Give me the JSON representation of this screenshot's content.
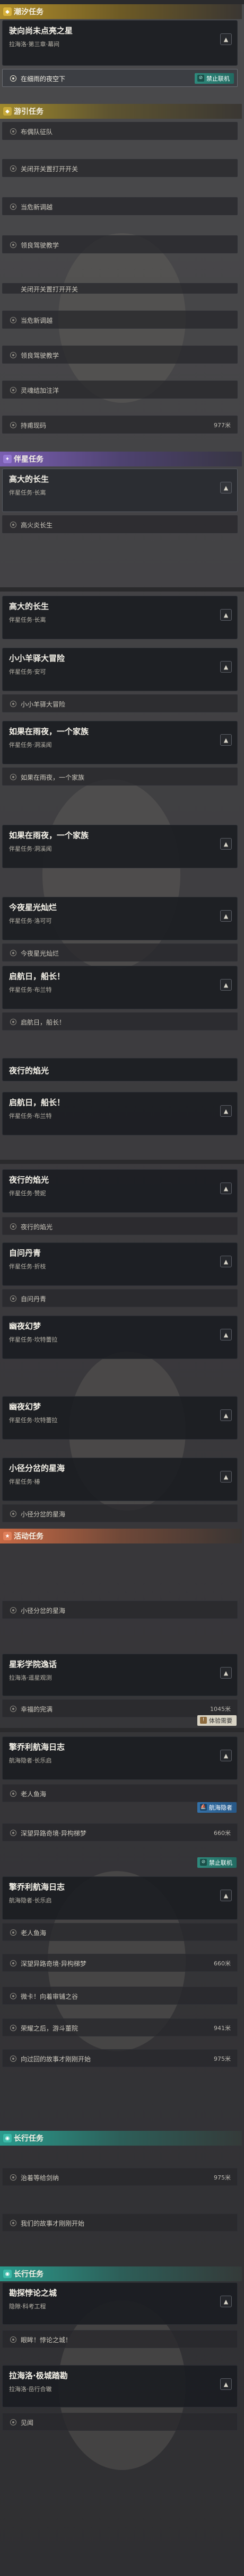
{
  "headers": {
    "main": "潮汐任务",
    "side": "游引任务",
    "companion": "伴星任务",
    "event": "活动任务",
    "daily": "长行任务",
    "daily2": "长行任务"
  },
  "cards": {
    "c1": {
      "title": "驶向尚未点亮之星",
      "sub": "拉海洛·第三章·幕间"
    },
    "c2": {
      "title": "高大的长生",
      "sub": "伴星任务·长离"
    },
    "c3": {
      "title": "高大的长生",
      "sub": "伴星任务·长离"
    },
    "c4": {
      "title": "小小羊驿大冒险",
      "sub": "伴星任务·安可"
    },
    "c5": {
      "title": "如果在雨夜，一个家族",
      "sub": "伴星任务·洞溪闻"
    },
    "c6": {
      "title": "如果在雨夜，一个家族",
      "sub": "伴星任务·洞溪闻"
    },
    "c7": {
      "title": "今夜星光灿烂",
      "sub": "伴星任务·洛可可"
    },
    "c8": {
      "title": "启航日，船长！",
      "sub": "伴星任务·布兰特"
    },
    "c9": {
      "title": "夜行的焰光",
      "sub": ""
    },
    "c10": {
      "title": "启航日，船长！",
      "sub": "伴星任务·布兰特"
    },
    "c11": {
      "title": "夜行的焰光",
      "sub": "伴星任务·赞妮"
    },
    "c12": {
      "title": "自问丹青",
      "sub": "伴星任务·折枝"
    },
    "c13": {
      "title": "幽夜幻梦",
      "sub": "伴星任务·坎特蕾拉"
    },
    "c14": {
      "title": "幽夜幻梦",
      "sub": "伴星任务·坎特蕾拉"
    },
    "c15": {
      "title": "小径分岔的星海",
      "sub": "伴星任务·椿"
    },
    "c16": {
      "title": "星彩学院逸话",
      "sub": "拉海洛·遥星观测"
    },
    "c17": {
      "title": "擎乔利航海日志",
      "sub": "航海隐者·长乐启"
    },
    "c18": {
      "title": "擎乔利航海日志",
      "sub": "航海隐者·长乐启"
    },
    "c19": {
      "title": "勘探悖论之城",
      "sub": "隐隙·科考工程"
    },
    "c20": {
      "title": "拉海洛·极城踏勘",
      "sub": "拉海洛·岳行合辙"
    }
  },
  "subs": {
    "s1": "在细雨的夜空下",
    "s2": "布偶队征队",
    "s3": "关闭开关置打开开关",
    "s4": "当危新调越",
    "s5": "领良驾驶教学",
    "s6": "关闭开关置打开开关",
    "s7": "当危新调越",
    "s8": "领良驾驶教学",
    "s9": "灵魂结加注洋",
    "s10": "持甫现码",
    "s11": "高火炎长生",
    "s12": "小小羊驿大冒险",
    "s13": "如果在雨夜，一个家族",
    "s14": "今夜星光灿烂",
    "s15": "启航日，船长！",
    "s16": "自问丹青",
    "s17": "夜行的焰光",
    "s18": "自问丹青",
    "s19": "小径分岔的星海",
    "s20": "小径分岔的星海",
    "s21": "幸福的完满",
    "s22": "老人鱼海",
    "s23": "深望异路奇境·异构梯梦",
    "s24": "老人鱼海",
    "s25": "深望异路奇境·异构梯梦",
    "s26": "微卡！向着审铺之谷",
    "s27": "荣耀之后，游斗董院",
    "s28": "向过回的故事才刚刚开始",
    "s29": "治着等给剑纳",
    "s30": "我们的故事才刚刚开始",
    "s31": "眼眸！悖论之城！",
    "s32": "见闻"
  },
  "dists": {
    "d1": "977米",
    "d2": "1045米",
    "d3": "660米",
    "d4": "660米",
    "d5": "941米",
    "d6": "975米",
    "d7": "975米"
  },
  "badges": {
    "ban": "禁止联机",
    "trial": "体验需要",
    "air": "航海隐者"
  },
  "ranks": {
    "r1": "1"
  }
}
